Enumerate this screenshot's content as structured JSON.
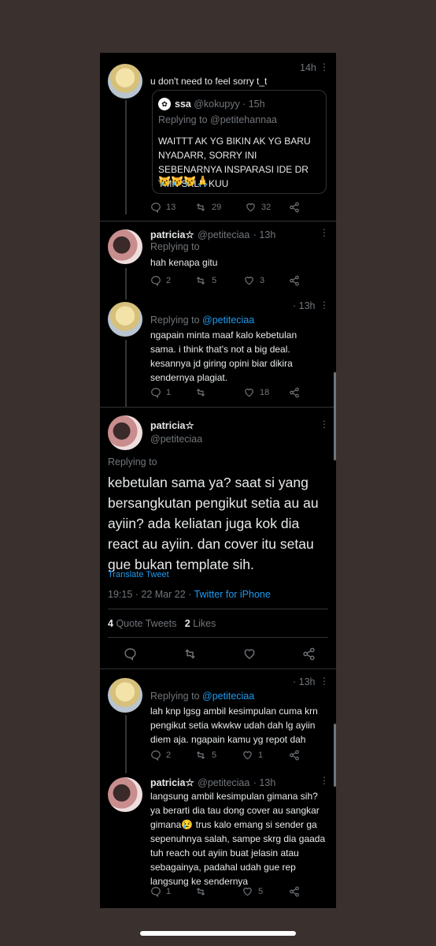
{
  "tweet1": {
    "time": "14h",
    "text": "u don't need to feel sorry t_t",
    "quote": {
      "name": "ssa",
      "handle": "@kokupyy",
      "time": "· 15h",
      "replying_label": "Replying to",
      "replying_to": "@petitehannaa",
      "text": "WAITTT AK YG BIKIN AK YG BARU NYADARR, SORRY INI SEBENARNYA INSPARASI IDE DR TMN SKLH KUU",
      "emoji": "😿😿😿🙏"
    },
    "replies": "13",
    "retweets": "29",
    "likes": "32"
  },
  "tweet2": {
    "name": "patricia☆",
    "handle": "@petiteciaa",
    "time": "· 13h",
    "replying_label": "Replying to",
    "text": "hah kenapa gitu",
    "replies": "2",
    "retweets": "5",
    "likes": "3"
  },
  "tweet3": {
    "time": "· 13h",
    "replying_label": "Replying to",
    "replying_to": "@petiteciaa",
    "text": "ngapain minta maaf kalo kebetulan sama. i think that's not a big deal. kesannya jd giring opini biar dikira sendernya plagiat.",
    "replies": "1",
    "retweets": "",
    "likes": "18"
  },
  "main": {
    "name": "patricia☆",
    "handle": "@petiteciaa",
    "replying_label": "Replying to",
    "text": "kebetulan sama ya? saat si yang bersangkutan pengikut setia au au ayiin? ada keliatan juga kok dia react au ayiin. dan cover itu setau gue bukan template sih.",
    "translate": "Translate Tweet",
    "datetime": "19:15 · 22 Mar 22 · ",
    "source": "Twitter for iPhone",
    "quote_count": "4",
    "quote_label": "Quote Tweets",
    "likes_count": "2",
    "likes_label": "Likes"
  },
  "reply1": {
    "time": "· 13h",
    "replying_label": "Replying to",
    "replying_to": "@petiteciaa",
    "text": "lah knp lgsg ambil kesimpulan cuma krn pengikut setia wkwkw udah dah lg ayiin diem aja. ngapain kamu yg repot dah",
    "replies": "2",
    "retweets": "5",
    "likes": "1"
  },
  "reply2": {
    "name": "patricia☆",
    "handle": "@petiteciaa",
    "time": "· 13h",
    "text": "langsung ambil kesimpulan gimana sih? ya berarti dia tau dong cover au sangkar gimana😢 trus kalo emang si sender ga sepenuhnya salah, sampe skrg dia gaada tuh reach out ayiin buat jelasin atau sebagainya, padahal udah gue rep langsung ke sendernya",
    "replies": "1",
    "retweets": "",
    "likes": "5"
  },
  "colors": {
    "background": "#000000",
    "text": "#e7e9ea",
    "muted": "#71767b",
    "accent": "#1d9bf0",
    "frame": "#3a302e"
  }
}
